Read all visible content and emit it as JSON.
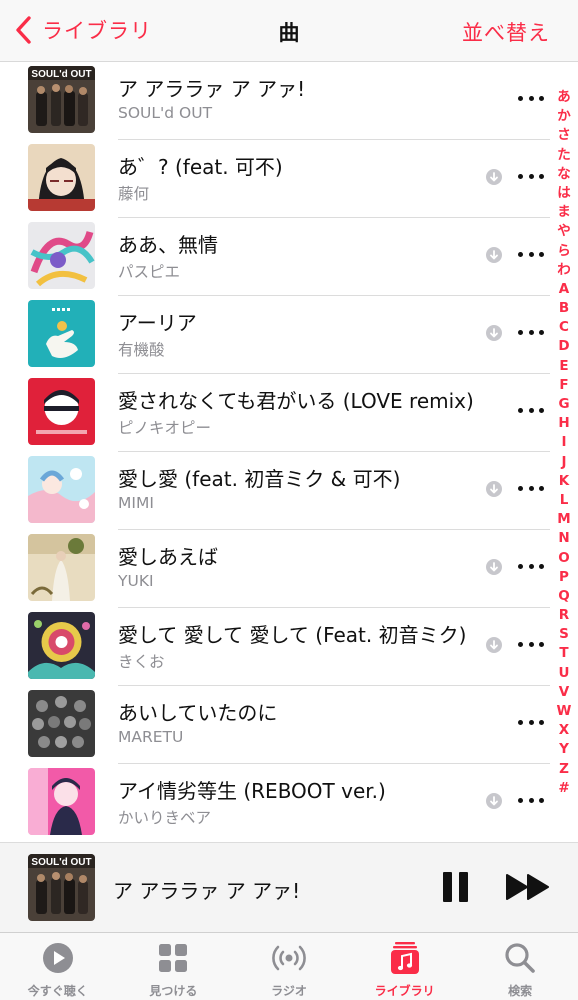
{
  "header": {
    "back_label": "ライブラリ",
    "title": "曲",
    "sort_label": "並べ替え"
  },
  "songs": [
    {
      "title": "ア アララァ ア アァ!",
      "artist": "SOUL'd OUT"
    },
    {
      "title": "あ゛? (feat. 可不)",
      "artist": "藤何"
    },
    {
      "title": "ああ、無情",
      "artist": "パスピエ"
    },
    {
      "title": "アーリア",
      "artist": "有機酸"
    },
    {
      "title": "愛されなくても君がいる (LOVE remix)",
      "artist": "ピノキオピー"
    },
    {
      "title": "愛し愛 (feat. 初音ミク & 可不)",
      "artist": "MIMI"
    },
    {
      "title": "愛しあえば",
      "artist": "YUKI"
    },
    {
      "title": "愛して 愛して 愛して (Feat. 初音ミク)",
      "artist": "きくお"
    },
    {
      "title": "あいしていたのに",
      "artist": "MARETU"
    },
    {
      "title": "アイ情劣等生 (REBOOT ver.)",
      "artist": "かいりきベア"
    }
  ],
  "album_art": [
    {
      "label": "SOUL'd OUT"
    }
  ],
  "index_letters": [
    "あ",
    "か",
    "さ",
    "た",
    "な",
    "は",
    "ま",
    "や",
    "ら",
    "わ",
    "A",
    "B",
    "C",
    "D",
    "E",
    "F",
    "G",
    "H",
    "I",
    "J",
    "K",
    "L",
    "M",
    "N",
    "O",
    "P",
    "Q",
    "R",
    "S",
    "T",
    "U",
    "V",
    "W",
    "X",
    "Y",
    "Z",
    "#"
  ],
  "now_playing": {
    "title": "ア アララァ ア アァ!"
  },
  "tabs": [
    {
      "label": "今すぐ聴く",
      "icon": "play-circle-icon"
    },
    {
      "label": "見つける",
      "icon": "grid-icon"
    },
    {
      "label": "ラジオ",
      "icon": "radio-broadcast-icon"
    },
    {
      "label": "ライブラリ",
      "icon": "music-note-icon"
    },
    {
      "label": "検索",
      "icon": "magnifier-icon"
    }
  ],
  "colors": {
    "accent": "#fa2d48",
    "secondary_text": "#8e8e93",
    "icon_gray": "#8e8e93"
  }
}
